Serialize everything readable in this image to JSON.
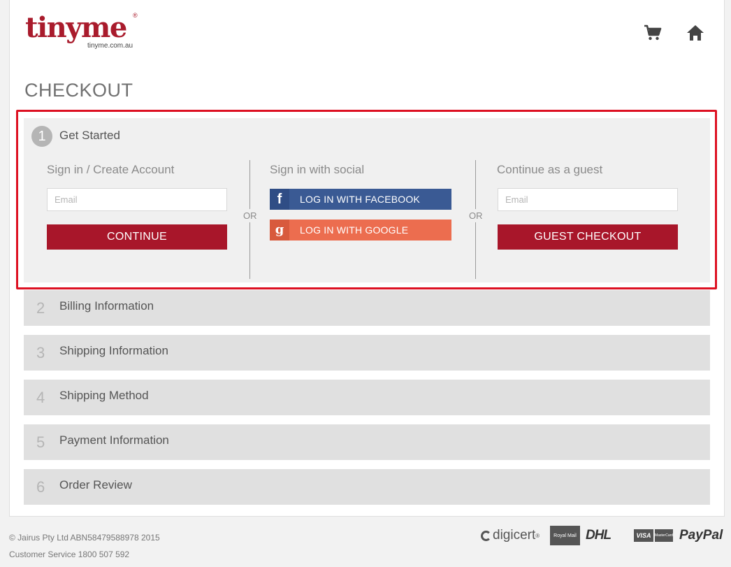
{
  "brand": {
    "logo_word": "tinyme",
    "logo_registered": "®",
    "logo_url": "tinyme.com.au",
    "accent_color": "#a8162a"
  },
  "header": {
    "icons": [
      "cart-icon",
      "home-icon"
    ]
  },
  "page": {
    "title": "CHECKOUT"
  },
  "steps": [
    {
      "number": "1",
      "title": "Get Started",
      "active": true,
      "sign_in": {
        "heading": "Sign in / Create Account",
        "email_placeholder": "Email",
        "button": "CONTINUE"
      },
      "or_label": "OR",
      "social": {
        "heading": "Sign in with social",
        "facebook": {
          "icon": "f",
          "label": "LOG IN WITH FACEBOOK"
        },
        "google": {
          "icon": "g",
          "label": "LOG IN WITH GOOGLE"
        }
      },
      "guest": {
        "heading": "Continue as a guest",
        "email_placeholder": "Email",
        "button": "GUEST CHECKOUT"
      }
    },
    {
      "number": "2",
      "title": "Billing Information"
    },
    {
      "number": "3",
      "title": "Shipping Information"
    },
    {
      "number": "4",
      "title": "Shipping Method"
    },
    {
      "number": "5",
      "title": "Payment Information"
    },
    {
      "number": "6",
      "title": "Order Review"
    }
  ],
  "footer": {
    "copyright": "© Jairus Pty Ltd ABN58479588978 2015",
    "customer_service": "Customer Service 1800 507 592",
    "badges": {
      "digicert": "digicert",
      "digicert_reg": "®",
      "royal_mail": "Royal Mail",
      "dhl": "DHL",
      "visa": "VISA",
      "mastercard": "MasterCard",
      "paypal": "PayPal"
    }
  }
}
